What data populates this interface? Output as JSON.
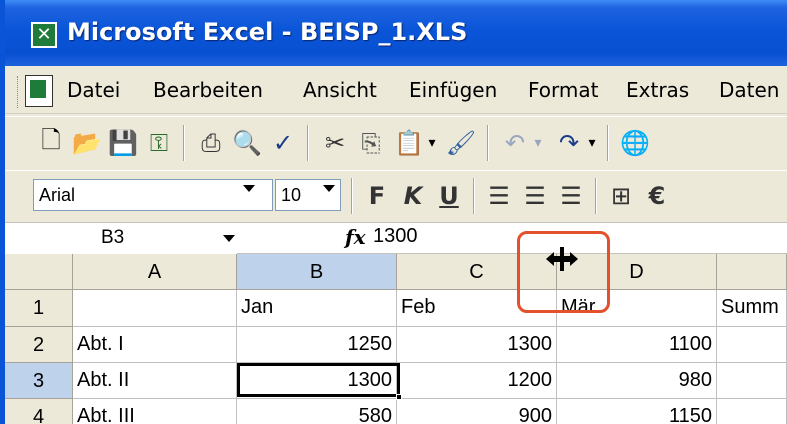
{
  "window": {
    "title": "Microsoft Excel - BEISP_1.XLS"
  },
  "menu": [
    {
      "label": "Datei"
    },
    {
      "label": "Bearbeiten"
    },
    {
      "label": "Ansicht"
    },
    {
      "label": "Einfügen"
    },
    {
      "label": "Format"
    },
    {
      "label": "Extras"
    },
    {
      "label": "Daten"
    }
  ],
  "format_toolbar": {
    "font": "Arial",
    "size": "10",
    "bold": "F",
    "italic": "K",
    "underline": "U",
    "currency": "€"
  },
  "formula_bar": {
    "name_box": "B3",
    "fx": "fx",
    "value": "1300"
  },
  "grid": {
    "columns": [
      "A",
      "B",
      "C",
      "D"
    ],
    "rows": [
      {
        "num": "1",
        "cells": [
          "",
          "Jan",
          "Feb",
          "Mär",
          "Summ"
        ]
      },
      {
        "num": "2",
        "cells": [
          "Abt. I",
          "1250",
          "1300",
          "1100",
          ""
        ]
      },
      {
        "num": "3",
        "cells": [
          "Abt. II",
          "1300",
          "1200",
          "980",
          ""
        ]
      },
      {
        "num": "4",
        "cells": [
          "Abt. III",
          "580",
          "900",
          "1150",
          ""
        ]
      }
    ],
    "selected_column": "B",
    "selected_row": "3",
    "active_cell": "B3"
  },
  "colors": {
    "title_bar": "#0a55d8",
    "selection": "#bfd2ec",
    "highlight": "#e2502c"
  }
}
